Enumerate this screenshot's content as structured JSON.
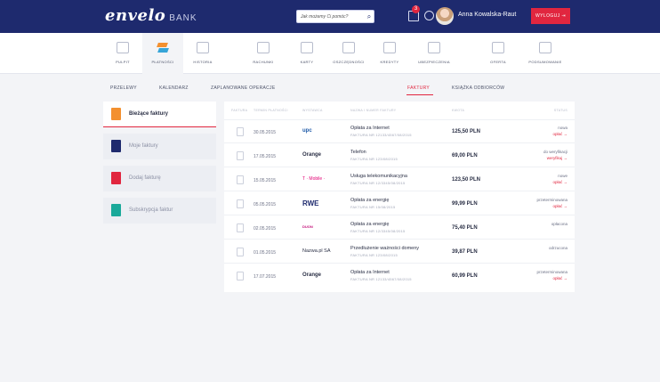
{
  "header": {
    "logo": "envelo",
    "logo_suffix": "BANK",
    "search_placeholder": "Jak możemy Ci pomóc?",
    "mail_count": "3",
    "user_name": "Anna Kowalska-Raut",
    "logout_label": "WYLOGUJ"
  },
  "mainnav": {
    "items": [
      {
        "label": "PULPIT"
      },
      {
        "label": "PŁATNOŚCI"
      },
      {
        "label": "HISTORIA"
      },
      {
        "label": "RACHUNKI"
      },
      {
        "label": "KARTY"
      },
      {
        "label": "OSZCZĘDNOŚCI"
      },
      {
        "label": "KREDYTY"
      },
      {
        "label": "UBEZPIECZENIA"
      },
      {
        "label": "OFERTA"
      },
      {
        "label": "PODSUMOWANIE"
      }
    ]
  },
  "subnav": {
    "items": [
      {
        "label": "PRZELEWY"
      },
      {
        "label": "KALENDARZ"
      },
      {
        "label": "ZAPLANOWANE OPERACJE"
      },
      {
        "label": "FAKTURY"
      },
      {
        "label": "KSIĄŻKA ODBIORCÓW"
      }
    ]
  },
  "sidebar": {
    "items": [
      {
        "label": "Bieżące faktury",
        "color": "#f3902f"
      },
      {
        "label": "Moje faktury",
        "color": "#1e2a6e"
      },
      {
        "label": "Dodaj fakturę",
        "color": "#e1263f"
      },
      {
        "label": "Subskrypcja faktur",
        "color": "#1aa99a"
      }
    ]
  },
  "table": {
    "headers": [
      "FAKTURA",
      "TERMIN PŁATNOŚCI",
      "WYSTAWCA",
      "NAZWA I NUMER FAKTURY",
      "KWOTA",
      "STATUS"
    ],
    "rows": [
      {
        "date": "30.05.2015",
        "issuer": "upc",
        "title": "Opłata za Internet",
        "sub": "FAKTURA NR 12133/4567/08/2015",
        "amount": "125,50 PLN",
        "status": "nowa",
        "action": "opłać →"
      },
      {
        "date": "17.05.2015",
        "issuer": "Orange",
        "title": "Telefon",
        "sub": "FAKTURA NR 123/08/2015",
        "amount": "69,00 PLN",
        "status": "do weryfikacji",
        "action": "weryfikuj →"
      },
      {
        "date": "15.05.2015",
        "issuer": "T · Mobile ·",
        "title": "Usługa telekomunikacyjna",
        "sub": "FAKTURA NR 12/3345/08/2015",
        "amount": "123,50 PLN",
        "status": "nowe",
        "action": "opłać →"
      },
      {
        "date": "05.05.2015",
        "issuer": "RWE",
        "title": "Opłata za energię",
        "sub": "FAKTURA NR 15/08/2015",
        "amount": "99,99 PLN",
        "status": "przeterminowana",
        "action": "opłać →"
      },
      {
        "date": "02.05.2015",
        "issuer": "DUON",
        "title": "Opłata za energię",
        "sub": "FAKTURA NR 12/3345/08/2015",
        "amount": "75,40 PLN",
        "status": "opłacona",
        "action": ""
      },
      {
        "date": "01.05.2015",
        "issuer": "Nazwa.pl SA",
        "title": "Przedłużenie ważności domeny",
        "sub": "FAKTURA NR 123/08/2015",
        "amount": "39,87 PLN",
        "status": "odrzucona",
        "action": ""
      },
      {
        "date": "17.07.2015",
        "issuer": "Orange",
        "title": "Opłata za Internet",
        "sub": "FAKTURA NR 12133/4567/08/2015",
        "amount": "60,99 PLN",
        "status": "przeterminowana",
        "action": "opłać →"
      }
    ]
  }
}
